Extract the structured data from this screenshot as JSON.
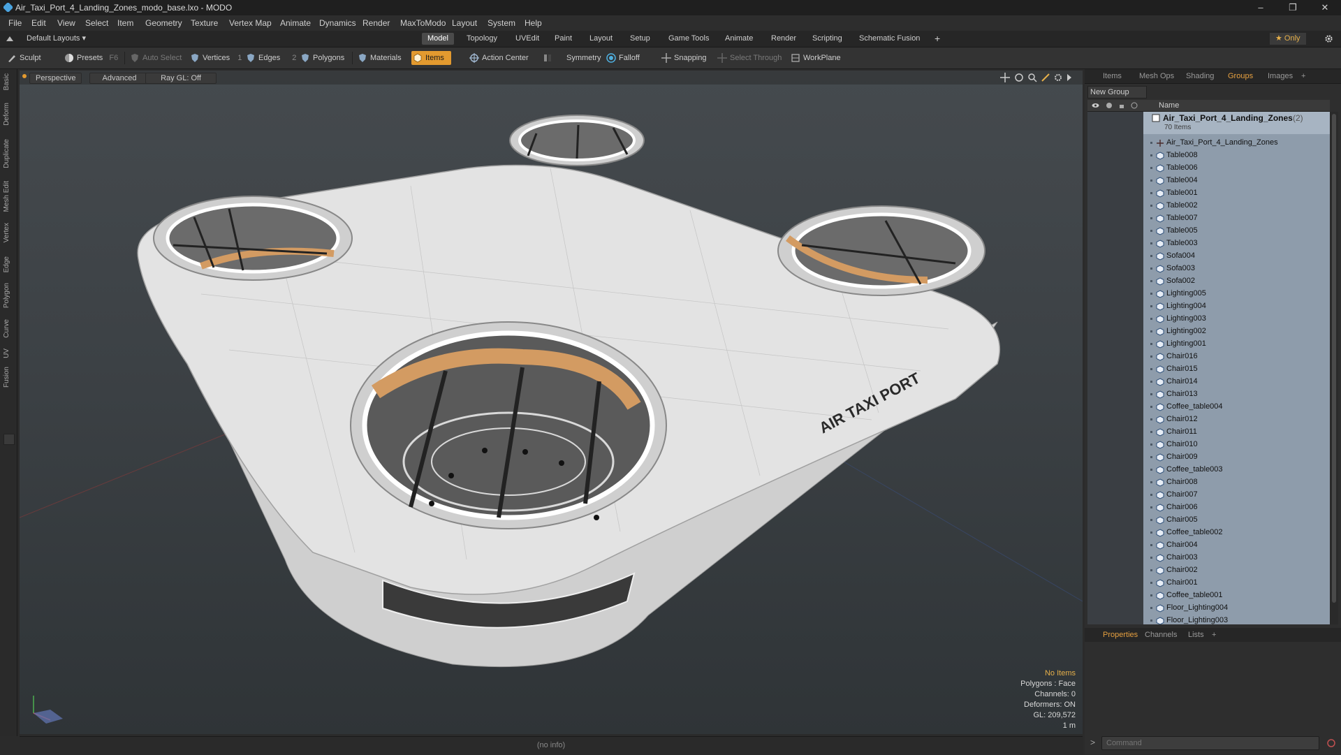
{
  "window": {
    "title": "Air_Taxi_Port_4_Landing_Zones_modo_base.lxo - MODO",
    "minimize": "–",
    "maximize": "❐",
    "close": "✕"
  },
  "menu": [
    "File",
    "Edit",
    "View",
    "Select",
    "Item",
    "Geometry",
    "Texture",
    "Vertex Map",
    "Animate",
    "Dynamics",
    "Render",
    "MaxToModo",
    "Layout",
    "System",
    "Help"
  ],
  "layoutbar": {
    "layouts_label": "Default Layouts ▾",
    "tabs": [
      "Model",
      "Topology",
      "UVEdit",
      "Paint",
      "Layout",
      "Setup",
      "Game Tools",
      "Animate",
      "Render",
      "Scripting",
      "Schematic Fusion"
    ],
    "active_tab": "Model",
    "add": "+",
    "only": "★ Only"
  },
  "toolbar": {
    "sculpt": "Sculpt",
    "presets": "Presets",
    "presets_key": "F6",
    "auto_select": "Auto Select",
    "vertices": "Vertices",
    "vertices_count": "1",
    "edges": "Edges",
    "edges_count": "2",
    "polygons": "Polygons",
    "materials": "Materials",
    "items": "Items",
    "action_center": "Action Center",
    "symmetry": "Symmetry",
    "falloff": "Falloff",
    "snapping": "Snapping",
    "select_through": "Select Through",
    "workplane": "WorkPlane"
  },
  "left_tabs": [
    "Basic",
    "Deform",
    "Duplicate",
    "Mesh Edit",
    "Vertex",
    "Edge",
    "Polygon",
    "Curve",
    "UV",
    "Fusion"
  ],
  "viewport": {
    "view": "Perspective",
    "shading": "Advanced",
    "raygl": "Ray GL: Off",
    "sign_text": "AIR TAXI PORT",
    "info": {
      "selection": "No Items",
      "polygons": "Polygons : Face",
      "channels": "Channels: 0",
      "deformers": "Deformers: ON",
      "gl": "GL: 209,572",
      "scale": "1 m"
    }
  },
  "status": "(no info)",
  "right_panel": {
    "tabs": [
      "Items",
      "Mesh Ops",
      "Shading",
      "Groups",
      "Images"
    ],
    "active_tab": "Groups",
    "add": "+",
    "new_group": "New Group",
    "col_name": "Name",
    "group": {
      "name": "Air_Taxi_Port_4_Landing_Zones",
      "count": "(2)",
      "sub": "70 Items"
    },
    "items": [
      "Air_Taxi_Port_4_Landing_Zones",
      "Table008",
      "Table006",
      "Table004",
      "Table001",
      "Table002",
      "Table007",
      "Table005",
      "Table003",
      "Sofa004",
      "Sofa003",
      "Sofa002",
      "Lighting005",
      "Lighting004",
      "Lighting003",
      "Lighting002",
      "Lighting001",
      "Chair016",
      "Chair015",
      "Chair014",
      "Chair013",
      "Coffee_table004",
      "Chair012",
      "Chair011",
      "Chair010",
      "Chair009",
      "Coffee_table003",
      "Chair008",
      "Chair007",
      "Chair006",
      "Chair005",
      "Coffee_table002",
      "Chair004",
      "Chair003",
      "Chair002",
      "Chair001",
      "Coffee_table001",
      "Floor_Lighting004",
      "Floor_Lighting003"
    ],
    "bottom_tabs": [
      "Properties",
      "Channels",
      "Lists"
    ],
    "bottom_active": "Properties",
    "command_placeholder": "Command",
    "command_prompt": ">"
  },
  "colors": {
    "accent": "#e39a2f",
    "list_bg": "#8e9cab",
    "viewport_top": "#454a4e",
    "viewport_bottom": "#2f3437"
  }
}
